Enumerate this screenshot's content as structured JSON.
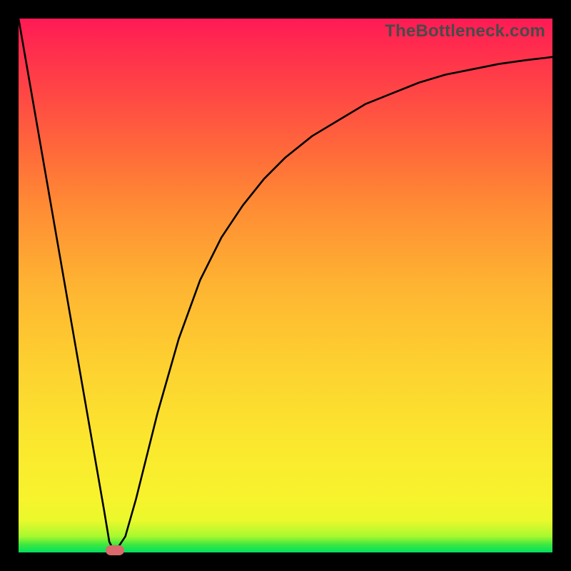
{
  "watermark": "TheBottleneck.com",
  "marker": {
    "color": "#d9696b"
  },
  "chart_data": {
    "type": "line",
    "title": "",
    "xlabel": "",
    "ylabel": "",
    "xlim": [
      0,
      100
    ],
    "ylim": [
      0,
      100
    ],
    "background_gradient": {
      "direction": "bottom-to-top",
      "stops": [
        {
          "pos": 0,
          "color": "#00e060"
        },
        {
          "pos": 3,
          "color": "#a8f82f"
        },
        {
          "pos": 10,
          "color": "#f7f32d"
        },
        {
          "pos": 35,
          "color": "#fdd130"
        },
        {
          "pos": 65,
          "color": "#ff8b34"
        },
        {
          "pos": 85,
          "color": "#ff4a44"
        },
        {
          "pos": 100,
          "color": "#ff1a55"
        }
      ]
    },
    "series": [
      {
        "name": "bottleneck-curve",
        "color": "#000000",
        "x": [
          0,
          4,
          8,
          12,
          16,
          17,
          18,
          20,
          22,
          24,
          26,
          28,
          30,
          34,
          38,
          42,
          46,
          50,
          55,
          60,
          65,
          70,
          75,
          80,
          85,
          90,
          95,
          100
        ],
        "y": [
          100,
          77,
          54,
          31,
          8,
          2,
          0,
          3,
          10,
          18,
          26,
          33,
          40,
          51,
          59,
          65,
          70,
          74,
          78,
          81,
          84,
          86,
          88,
          89.5,
          90.5,
          91.5,
          92.2,
          92.8
        ]
      }
    ],
    "marker_point": {
      "x": 18,
      "y": 0
    }
  }
}
